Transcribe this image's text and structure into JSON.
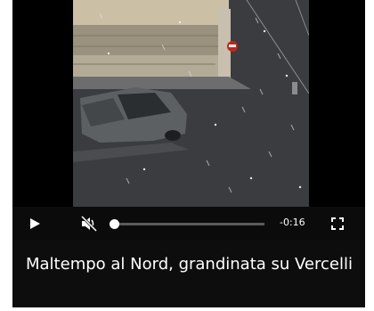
{
  "video": {
    "scene_icon": "street-hail-video-frame",
    "progress_fraction": 0.03,
    "time_remaining": "-0:16",
    "icons": {
      "play": "play-icon",
      "mute": "volume-muted-icon",
      "fullscreen": "fullscreen-icon"
    }
  },
  "article": {
    "title": "Maltempo al Nord, grandinata su Vercelli"
  },
  "colors": {
    "card_background": "#0d0d0d",
    "controls_background": "#0c0c0c",
    "text": "#ffffff",
    "seek_track": "#5a5a5a"
  }
}
